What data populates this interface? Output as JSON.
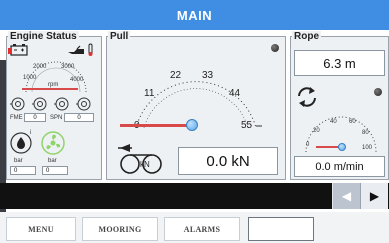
{
  "title": "MAIN",
  "engine": {
    "title": "Engine Status",
    "rpm_label": "rpm",
    "rpm_ticks": [
      "1000",
      "2000",
      "3000",
      "4000"
    ],
    "fme_label": "FME",
    "fme_value": "0",
    "spn_label": "SPN",
    "spn_value": "0",
    "bar_label_1": "bar",
    "bar_label_2": "bar",
    "bar_value_1": "0",
    "bar_value_2": "0"
  },
  "pull": {
    "title": "Pull",
    "ticks": [
      "0",
      "11",
      "22",
      "33",
      "44",
      "55"
    ],
    "value": "0.0 kN",
    "icon_unit": "kN"
  },
  "rope": {
    "title": "Rope",
    "length": "6.3 m",
    "ticks": [
      "0",
      "20",
      "40",
      "60",
      "80",
      "100"
    ],
    "speed": "0.0 m/min"
  },
  "nav": {
    "prev": "◀",
    "next": "▶"
  },
  "buttons": {
    "menu": "MENU",
    "mooring": "MOORING",
    "alarms": "ALARMS",
    "empty": ""
  },
  "colors": {
    "title_bar": "#3f8ee3",
    "needle": "#d84a4a",
    "knob": "#5aa7e8"
  }
}
